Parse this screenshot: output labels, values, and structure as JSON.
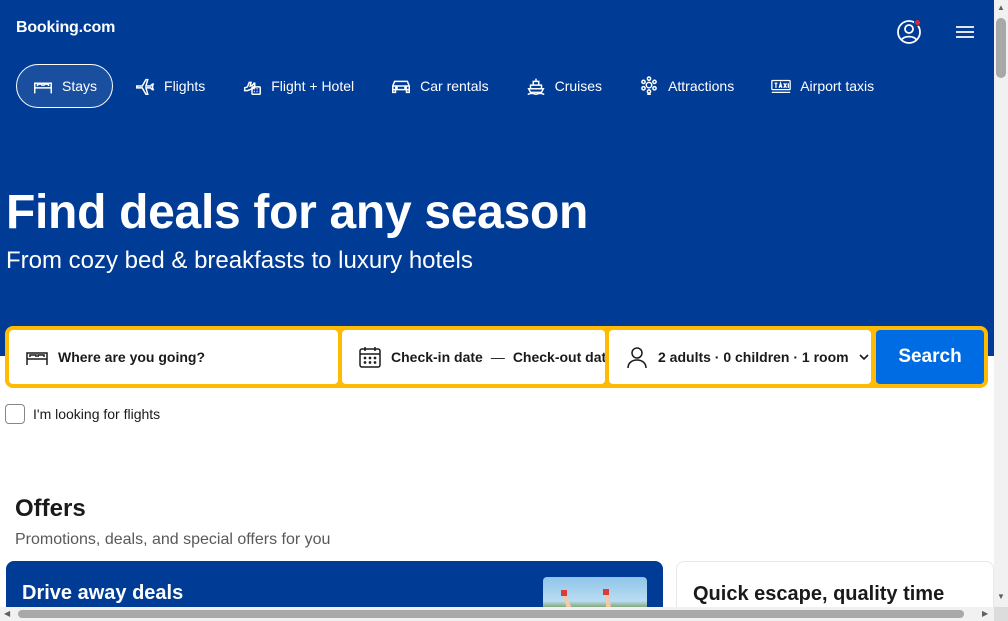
{
  "header": {
    "logo": "Booking.com",
    "account_icon": "account-icon",
    "menu_icon": "hamburger-menu-icon"
  },
  "nav": {
    "items": [
      {
        "label": "Stays",
        "icon": "bed-icon",
        "active": true
      },
      {
        "label": "Flights",
        "icon": "plane-icon",
        "active": false
      },
      {
        "label": "Flight + Hotel",
        "icon": "flight-hotel-icon",
        "active": false
      },
      {
        "label": "Car rentals",
        "icon": "car-icon",
        "active": false
      },
      {
        "label": "Cruises",
        "icon": "ship-icon",
        "active": false
      },
      {
        "label": "Attractions",
        "icon": "attractions-icon",
        "active": false
      },
      {
        "label": "Airport taxis",
        "icon": "taxi-icon",
        "active": false
      }
    ]
  },
  "hero": {
    "title": "Find deals for any season",
    "subtitle": "From cozy bed & breakfasts to luxury hotels"
  },
  "search": {
    "destination_placeholder": "Where are you going?",
    "checkin": "Check-in date",
    "date_separator": "—",
    "checkout": "Check-out date",
    "occupancy": "2 adults · 0 children · 1 room",
    "button": "Search"
  },
  "flights_checkbox": {
    "label": "I'm looking for flights",
    "checked": false
  },
  "offers": {
    "title": "Offers",
    "subtitle": "Promotions, deals, and special offers for you",
    "cards": [
      {
        "title": "Drive away deals"
      },
      {
        "title": "Quick escape, quality time"
      }
    ]
  },
  "colors": {
    "brand_blue": "#003b95",
    "search_yellow": "#febb02",
    "button_blue": "#006ce4",
    "notification_red": "#e0232f"
  }
}
